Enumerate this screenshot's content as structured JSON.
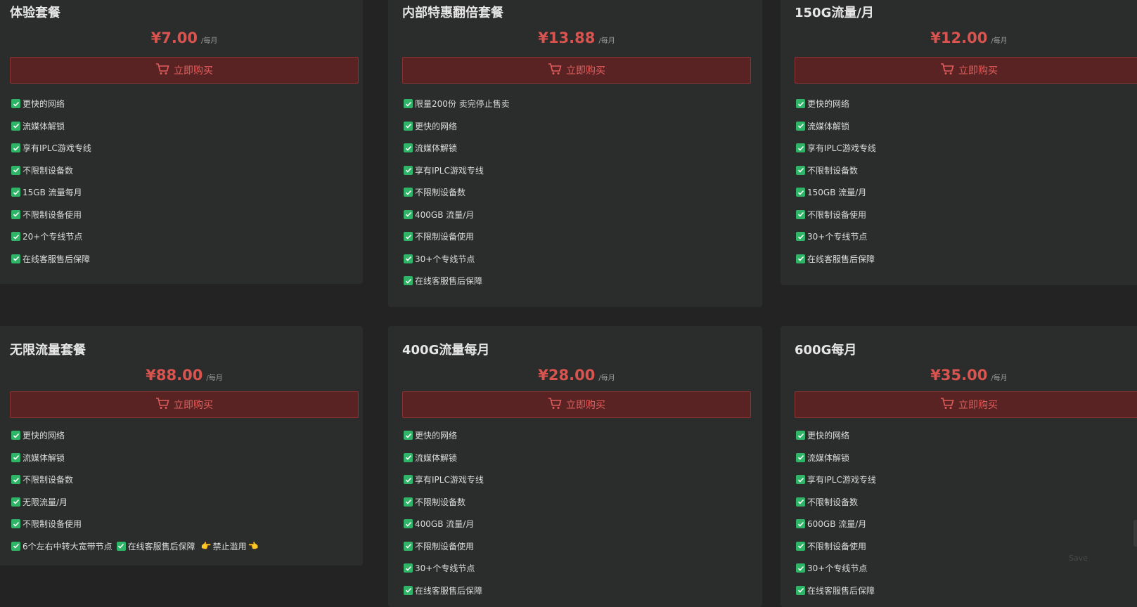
{
  "colors": {
    "accent": "#d9534f",
    "check": "#2fb468",
    "card": "#2b2c2c",
    "background": "#232323"
  },
  "icons": {
    "buy": "cart-icon",
    "feature": "checkbox-check-icon"
  },
  "plans": [
    {
      "title": "体验套餐",
      "price": "¥7.00",
      "unit": "/每月",
      "buy_label": "立即购买",
      "features": [
        "更快的网络",
        "流媒体解锁",
        "享有IPLC游戏专线",
        "不限制设备数",
        "15GB 流量每月",
        "不限制设备使用",
        "20+个专线节点",
        "在线客服售后保障"
      ]
    },
    {
      "title": "内部特惠翻倍套餐",
      "price": "¥13.88",
      "unit": "/每月",
      "buy_label": "立即购买",
      "features": [
        "限量200份 卖完停止售卖",
        "更快的网络",
        "流媒体解锁",
        "享有IPLC游戏专线",
        "不限制设备数",
        "400GB 流量/月",
        "不限制设备使用",
        "30+个专线节点",
        "在线客服售后保障"
      ]
    },
    {
      "title": "150G流量/月",
      "price": "¥12.00",
      "unit": "/每月",
      "buy_label": "立即购买",
      "features": [
        "更快的网络",
        "流媒体解锁",
        "享有IPLC游戏专线",
        "不限制设备数",
        "150GB 流量/月",
        "不限制设备使用",
        "30+个专线节点",
        "在线客服售后保障"
      ]
    },
    {
      "title": "无限流量套餐",
      "price": "¥88.00",
      "unit": "/每月",
      "buy_label": "立即购买",
      "features": [
        "更快的网络",
        "流媒体解锁",
        "不限制设备数",
        "无限流量/月",
        "不限制设备使用"
      ],
      "last_line": {
        "part1": "6个左右中转大宽带节点",
        "part2": "在线客服售后保障",
        "emoji_left": "👉",
        "part3": "禁止滥用",
        "emoji_right": "👈"
      }
    },
    {
      "title": "400G流量每月",
      "price": "¥28.00",
      "unit": "/每月",
      "buy_label": "立即购买",
      "features": [
        "更快的网络",
        "流媒体解锁",
        "享有IPLC游戏专线",
        "不限制设备数",
        "400GB 流量/月",
        "不限制设备使用",
        "30+个专线节点",
        "在线客服售后保障"
      ]
    },
    {
      "title": "600G每月",
      "price": "¥35.00",
      "unit": "/每月",
      "buy_label": "立即购买",
      "features": [
        "更快的网络",
        "流媒体解锁",
        "享有IPLC游戏专线",
        "不限制设备数",
        "600GB 流量/月",
        "不限制设备使用",
        "30+个专线节点",
        "在线客服售后保障"
      ]
    }
  ],
  "save_label": "Save"
}
